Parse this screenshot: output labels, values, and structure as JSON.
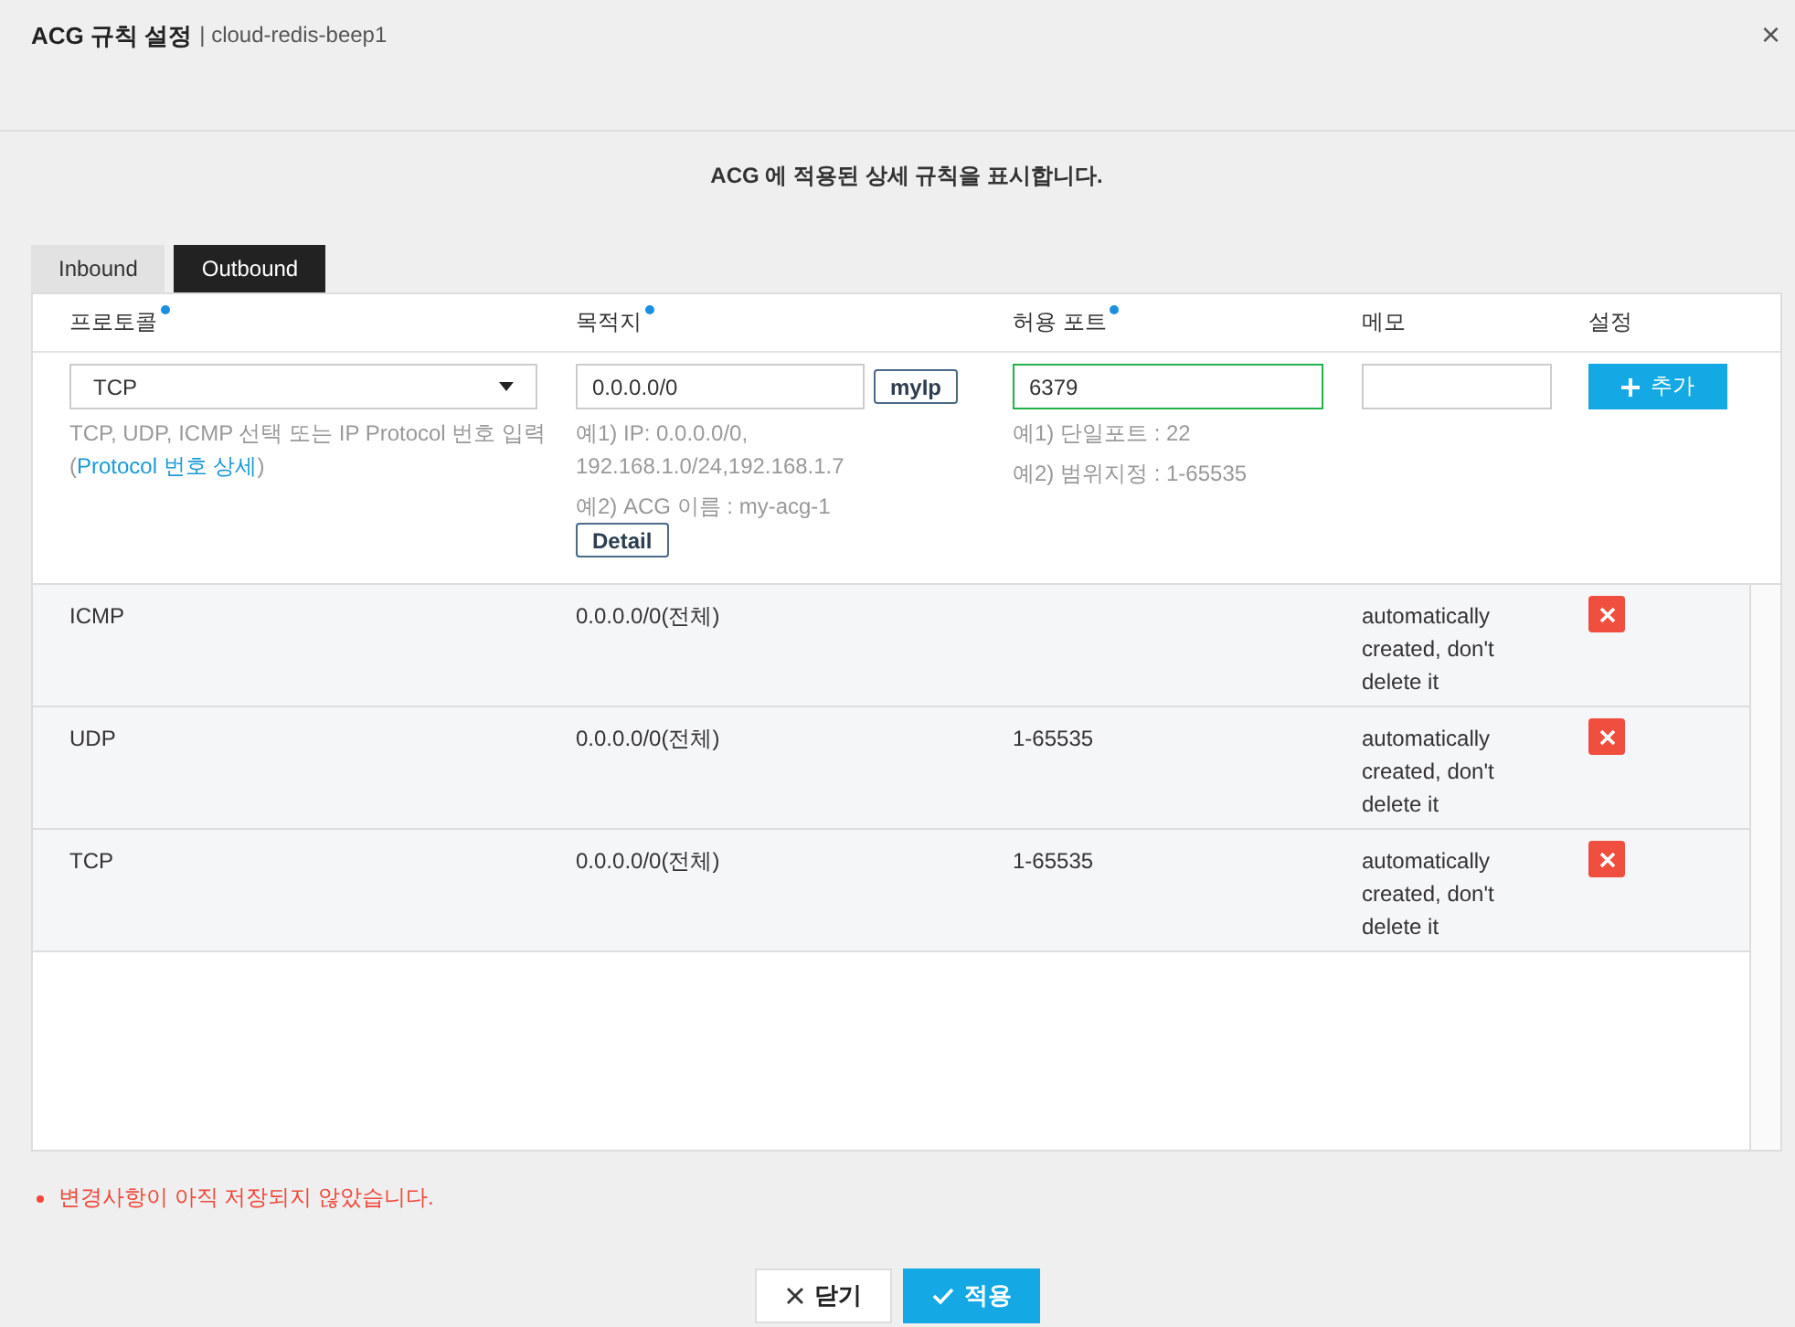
{
  "window": {
    "title": "ACG 규칙 설정",
    "subtitle": "| cloud-redis-beep1",
    "close": "×"
  },
  "description": "ACG 에 적용된 상세 규칙을 표시합니다.",
  "tabs": [
    {
      "label": "Inbound",
      "selected": false
    },
    {
      "label": "Outbound",
      "selected": true
    }
  ],
  "columns": [
    {
      "label": "프로토콜",
      "required": true
    },
    {
      "label": "목적지",
      "required": true
    },
    {
      "label": "허용 포트",
      "required": true
    },
    {
      "label": "메모",
      "required": false
    },
    {
      "label": "설정",
      "required": false
    }
  ],
  "form": {
    "protocol": {
      "value": "TCP",
      "hint": "TCP, UDP, ICMP 선택 또는 IP Protocol 번호 입력",
      "link_open": "(",
      "link": "Protocol 번호 상세",
      "link_close": ")"
    },
    "destination": {
      "value": "0.0.0.0/0",
      "myip": "myIp",
      "examples": [
        "예1) IP: 0.0.0.0/0, 192.168.1.0/24,192.168.1.7",
        "예2) ACG 이름 : my-acg-1"
      ],
      "detail": "Detail"
    },
    "port": {
      "value": "6379",
      "examples": [
        "예1) 단일포트 : 22",
        "예2) 범위지정 : 1-65535"
      ]
    },
    "add": "추가"
  },
  "rows": [
    {
      "protocol": "ICMP",
      "destination": "0.0.0.0/0(전체)",
      "port": "",
      "memo": "automatically created, don't delete it"
    },
    {
      "protocol": "UDP",
      "destination": "0.0.0.0/0(전체)",
      "port": "1-65535",
      "memo": "automatically created, don't delete it"
    },
    {
      "protocol": "TCP",
      "destination": "0.0.0.0/0(전체)",
      "port": "1-65535",
      "memo": "automatically created, don't delete it"
    }
  ],
  "warning": "변경사항이 아직 저장되지 않았습니다.",
  "buttons": {
    "close": "닫기",
    "apply": "적용"
  }
}
